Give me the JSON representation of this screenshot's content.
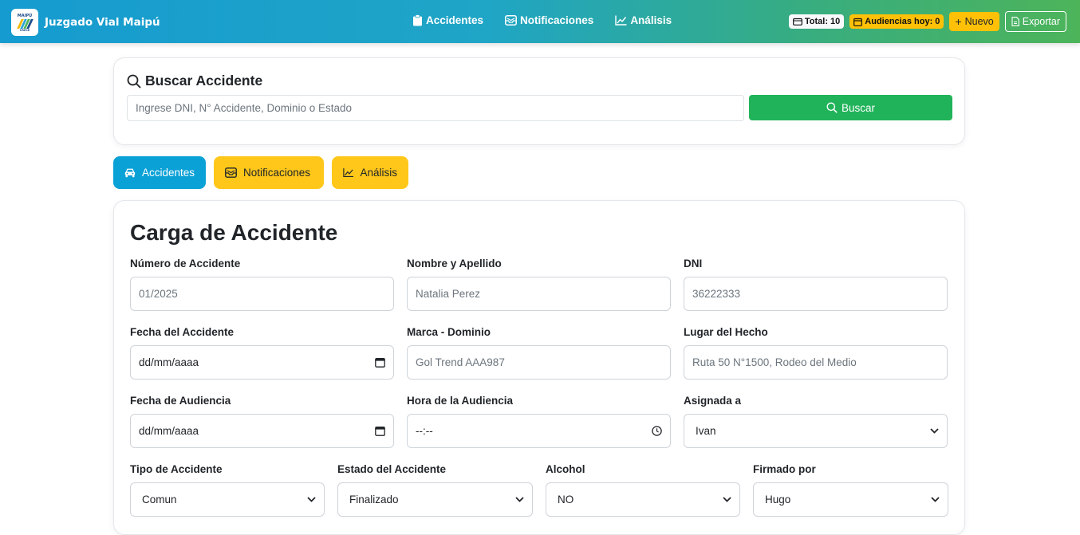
{
  "navbar": {
    "brand_name": "Juzgado Vial Maipú",
    "logo_text_top": "MAIPÚ",
    "logo_text_bottom": "CRECE",
    "links": [
      {
        "label": "Accidentes",
        "icon": "clipboard-icon"
      },
      {
        "label": "Notificaciones",
        "icon": "envelope-icon"
      },
      {
        "label": "Análisis",
        "icon": "chart-line-icon"
      }
    ],
    "total_badge": "Total: 10",
    "audiencias_badge": "Audiencias hoy: 0",
    "nuevo_label": "Nuevo",
    "exportar_label": "Exportar"
  },
  "search": {
    "title": "Buscar Accidente",
    "placeholder": "Ingrese DNI, N° Accidente, Dominio o Estado",
    "button_label": "Buscar"
  },
  "tabs": [
    {
      "label": "Accidentes",
      "icon": "car-icon",
      "active": true
    },
    {
      "label": "Notificaciones",
      "icon": "envelope-icon",
      "active": false
    },
    {
      "label": "Análisis",
      "icon": "chart-line-icon",
      "active": false
    }
  ],
  "form": {
    "title": "Carga de Accidente",
    "fields": {
      "numero": {
        "label": "Número de Accidente",
        "placeholder": "01/2025"
      },
      "nombre": {
        "label": "Nombre y Apellido",
        "placeholder": "Natalia Perez"
      },
      "dni": {
        "label": "DNI",
        "placeholder": "36222333"
      },
      "fecha_accidente": {
        "label": "Fecha del Accidente",
        "value": "dd/mm/aaaa"
      },
      "marca": {
        "label": "Marca - Dominio",
        "placeholder": "Gol Trend AAA987"
      },
      "lugar": {
        "label": "Lugar del Hecho",
        "placeholder": "Ruta 50 N°1500, Rodeo del Medio"
      },
      "fecha_audiencia": {
        "label": "Fecha de Audiencia",
        "value": "dd/mm/aaaa"
      },
      "hora_audiencia": {
        "label": "Hora de la Audiencia",
        "value": "--:--"
      },
      "asignada": {
        "label": "Asignada a",
        "value": "Ivan"
      },
      "tipo": {
        "label": "Tipo de Accidente",
        "value": "Comun"
      },
      "estado": {
        "label": "Estado del Accidente",
        "value": "Finalizado"
      },
      "alcohol": {
        "label": "Alcohol",
        "value": "NO"
      },
      "firmado": {
        "label": "Firmado por",
        "value": "Hugo"
      }
    }
  },
  "colors": {
    "navbar_gradient_start": "#169bd0",
    "navbar_gradient_end": "#4db45a",
    "search_button": "#21b35a",
    "tab_active": "#0aa1d6",
    "tab_yellow": "#ffc71a",
    "badge_yellow": "#ffc107"
  }
}
